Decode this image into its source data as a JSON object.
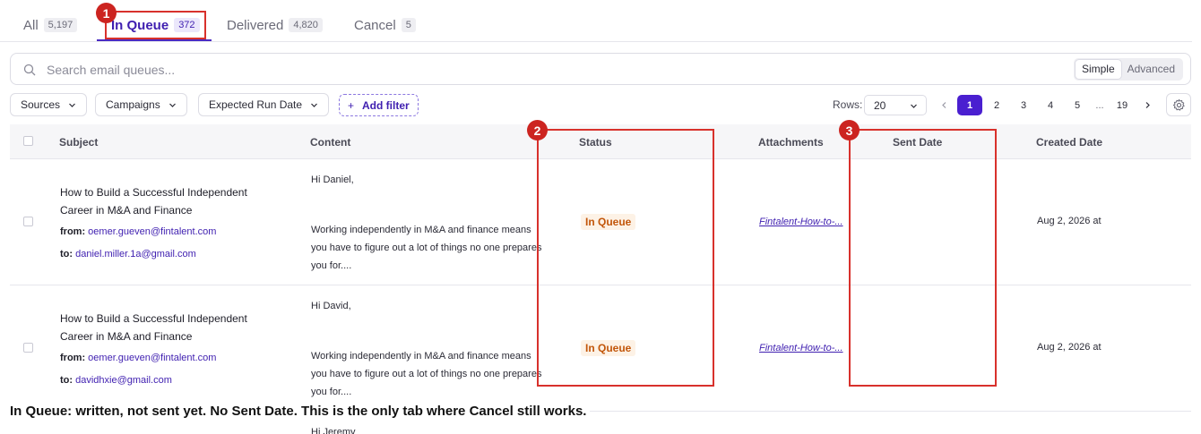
{
  "tabs": [
    {
      "label": "All",
      "count": "5,197"
    },
    {
      "label": "In Queue",
      "count": "372"
    },
    {
      "label": "Delivered",
      "count": "4,820"
    },
    {
      "label": "Cancel",
      "count": "5"
    }
  ],
  "search": {
    "placeholder": "Search email queues..."
  },
  "mode_toggle": {
    "simple": "Simple",
    "advanced": "Advanced"
  },
  "filters": {
    "sources": "Sources",
    "campaigns": "Campaigns",
    "expected_run_date": "Expected Run Date",
    "add_filter": "Add filter"
  },
  "pagination": {
    "rows_label": "Rows:",
    "rows_value": "20",
    "pages": [
      "1",
      "2",
      "3",
      "4",
      "5",
      "...",
      "19"
    ]
  },
  "table": {
    "columns": [
      "Subject",
      "Content",
      "Status",
      "Attachments",
      "Sent Date",
      "Created Date"
    ],
    "rows": [
      {
        "subject_line1": "How to Build a Successful Independent",
        "subject_line2": "Career in M&A and Finance",
        "from_label": "from:",
        "from": "oemer.gueven@fintalent.com",
        "to_label": "to:",
        "to": "daniel.miller.1a@gmail.com",
        "greeting": "Hi Daniel,",
        "body_line1": "Working independently in M&A and finance means",
        "body_line2": "you have to figure out a lot of things no one prepares",
        "body_line3": "you for....",
        "status": "In Queue",
        "attachment": "Fintalent-How-to-...",
        "sent_date": "",
        "created": "Aug 2, 2026 at"
      },
      {
        "subject_line1": "How to Build a Successful Independent",
        "subject_line2": "Career in M&A and Finance",
        "from_label": "from:",
        "from": "oemer.gueven@fintalent.com",
        "to_label": "to:",
        "to": "davidhxie@gmail.com",
        "greeting": "Hi David,",
        "body_line1": "Working independently in M&A and finance means",
        "body_line2": "you have to figure out a lot of things no one prepares",
        "body_line3": "you for....",
        "status": "In Queue",
        "attachment": "Fintalent-How-to-...",
        "sent_date": "",
        "created": "Aug 2, 2026 at"
      }
    ],
    "partial_row_greeting": "Hi Jeremy"
  },
  "annotations": {
    "markers": [
      "1",
      "2",
      "3"
    ],
    "caption": "In Queue: written, not sent yet. No Sent Date. This is the only tab where Cancel still works."
  },
  "colors": {
    "accent": "#4a1fd0",
    "status_queue": "#c2560a",
    "annotation": "#d8312c"
  }
}
